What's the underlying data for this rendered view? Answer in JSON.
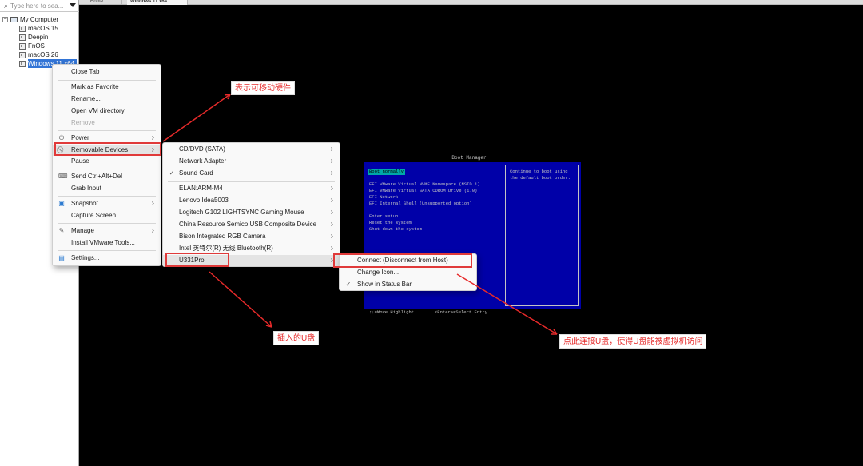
{
  "tabs": [
    {
      "label": "Home"
    },
    {
      "label": "Windows 11 x64"
    }
  ],
  "search": {
    "placeholder": "Type here to sea..."
  },
  "library": {
    "root": "My Computer",
    "vms": [
      "macOS 15",
      "Deepin",
      "FnOS",
      "macOS 26",
      "Windows 11 x64"
    ]
  },
  "context_menu": {
    "items": {
      "close_tab": "Close Tab",
      "favorite": "Mark as Favorite",
      "rename": "Rename...",
      "open_dir": "Open VM directory",
      "remove": "Remove",
      "power": "Power",
      "removable": "Removable Devices",
      "pause": "Pause",
      "send_cad": "Send Ctrl+Alt+Del",
      "grab": "Grab Input",
      "snapshot": "Snapshot",
      "capture": "Capture Screen",
      "manage": "Manage",
      "install_tools": "Install VMware Tools...",
      "settings": "Settings..."
    }
  },
  "devices_menu": {
    "items": [
      "CD/DVD (SATA)",
      "Network Adapter",
      "Sound Card",
      "ELAN:ARM-M4",
      "Lenovo Idea5003",
      "Logitech G102 LIGHTSYNC Gaming Mouse",
      "China Resource Semico USB Composite Device",
      "Bison Integrated RGB Camera",
      "Intel 英特尔(R) 无线 Bluetooth(R)",
      "U331Pro"
    ]
  },
  "usb_menu": {
    "connect": "Connect (Disconnect from Host)",
    "change_icon": "Change Icon...",
    "show_status": "Show in Status Bar"
  },
  "annotations": {
    "removable_note": "表示可移动硬件",
    "usb_note": "插入的U盘",
    "connect_note": "点此连接U盘，使得U盘能被虚拟机访问"
  },
  "boot": {
    "title": "Boot Manager",
    "selected": "Boot normally",
    "lines": [
      "EFI VMware Virtual NVME Namespace (NSID 1)",
      "EFI VMware Virtual SATA CDROM Drive (1.0)",
      "EFI Network",
      "EFI Internal Shell (Unsupported option)"
    ],
    "actions": [
      "Enter setup",
      "Reset the system",
      "Shut down the system"
    ],
    "help": [
      "Continue to boot using",
      "the default boot order."
    ],
    "footer_left": "↑↓=Move Highlight",
    "footer_right": "<Enter>=Select Entry"
  },
  "colors": {
    "annotation_red": "#e62a2a",
    "boot_blue": "#0000a8",
    "selection_blue": "#3375d6"
  }
}
